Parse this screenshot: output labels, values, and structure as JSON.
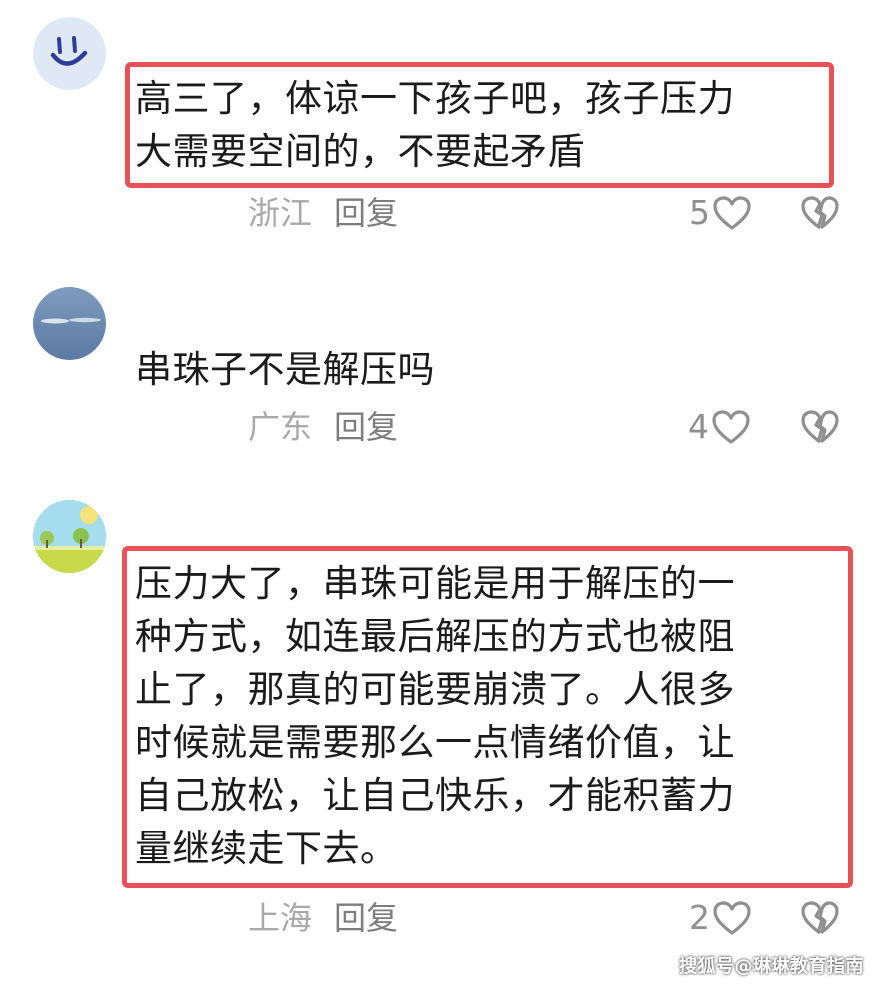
{
  "comments": [
    {
      "avatar": "smiley-avatar",
      "text_lines": [
        "高三了，体谅一下孩子吧，孩子压力",
        "大需要空间的，不要起矛盾"
      ],
      "location": "浙江",
      "reply_label": "回复",
      "likes": "5",
      "highlighted": true
    },
    {
      "avatar": "sky-avatar",
      "text_lines": [
        "串珠子不是解压吗"
      ],
      "location": "广东",
      "reply_label": "回复",
      "likes": "4",
      "highlighted": false
    },
    {
      "avatar": "landscape-avatar",
      "text_lines": [
        "压力大了，串珠可能是用于解压的一",
        "种方式，如连最后解压的方式也被阻",
        "止了，那真的可能要崩溃了。人很多",
        "时候就是需要那么一点情绪价值，让",
        "自己放松，让自己快乐，才能积蓄力",
        "量继续走下去。"
      ],
      "location": "上海",
      "reply_label": "回复",
      "likes": "2",
      "highlighted": true
    }
  ],
  "watermark": "搜狐号@琳琳教育指南",
  "colors": {
    "highlight_border": "#e8515a",
    "comment_text": "#1b1b1b",
    "location_text": "#a9a9a9",
    "reply_text": "#7d7d7d",
    "icon_stroke": "#8f8f8f"
  },
  "icons": {
    "like": "heart-outline-icon",
    "dislike": "broken-heart-icon"
  }
}
